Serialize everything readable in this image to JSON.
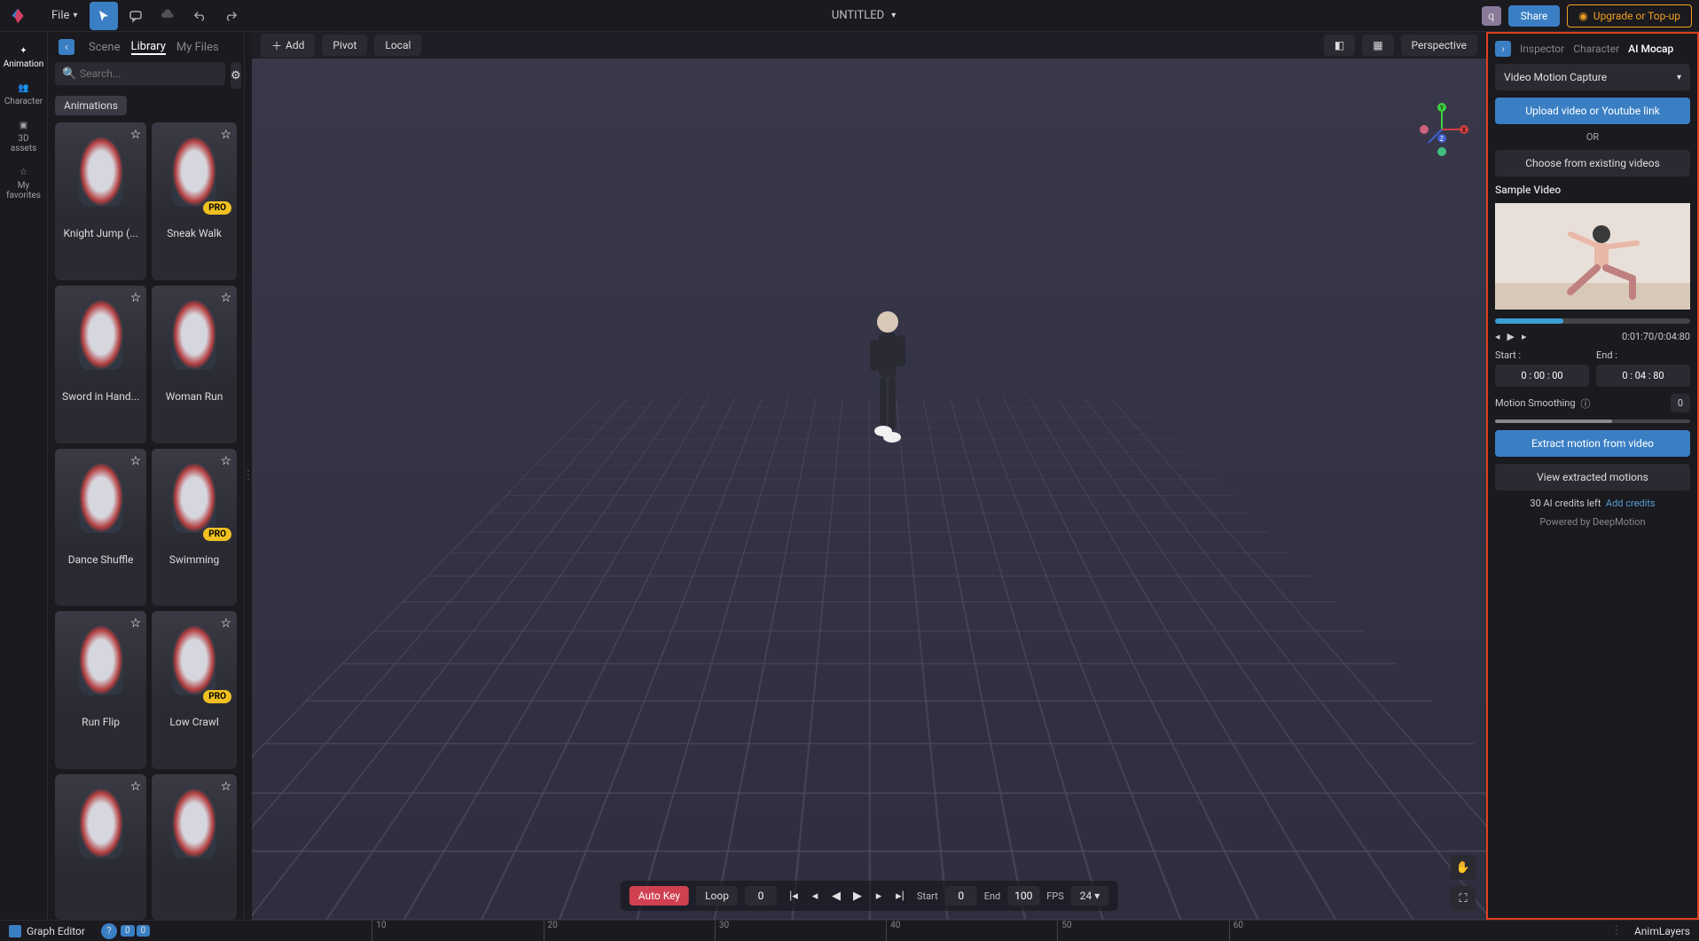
{
  "topbar": {
    "file_label": "File",
    "title": "UNTITLED",
    "avatar_letter": "q",
    "share_label": "Share",
    "upgrade_label": "Upgrade or Top-up"
  },
  "panel_tabs": {
    "scene": "Scene",
    "library": "Library",
    "myfiles": "My Files"
  },
  "search": {
    "placeholder": "Search..."
  },
  "filter_chip": "Animations",
  "rail": {
    "animation": "Animation",
    "character": "Character",
    "assets": "3D assets",
    "favorites": "My favorites"
  },
  "animations": [
    {
      "label": "Knight Jump (...",
      "pro": false
    },
    {
      "label": "Sneak Walk",
      "pro": true
    },
    {
      "label": "Sword in Hand...",
      "pro": false
    },
    {
      "label": "Woman Run",
      "pro": false
    },
    {
      "label": "Dance Shuffle",
      "pro": false
    },
    {
      "label": "Swimming",
      "pro": true
    },
    {
      "label": "Run Flip",
      "pro": false
    },
    {
      "label": "Low Crawl",
      "pro": true
    },
    {
      "label": "",
      "pro": false
    },
    {
      "label": "",
      "pro": false
    }
  ],
  "pro_badge": "PRO",
  "viewport": {
    "add_label": "Add",
    "pivot_label": "Pivot",
    "local_label": "Local",
    "perspective_label": "Perspective"
  },
  "playback": {
    "autokey": "Auto Key",
    "loop": "Loop",
    "frame": "0",
    "start_label": "Start",
    "start_val": "0",
    "end_label": "End",
    "end_val": "100",
    "fps_label": "FPS",
    "fps_val": "24"
  },
  "right": {
    "tabs": {
      "inspector": "Inspector",
      "character": "Character",
      "aimocap": "AI Mocap"
    },
    "mode": "Video Motion Capture",
    "upload": "Upload video or Youtube link",
    "or": "OR",
    "choose": "Choose from existing videos",
    "sample": "Sample Video",
    "time": "0:01:70/0:04:80",
    "start_label": "Start :",
    "start_val": "0 : 00 : 00",
    "end_label": "End :",
    "end_val": "0 : 04 : 80",
    "smoothing": "Motion Smoothing",
    "smoothing_val": "0",
    "extract": "Extract motion from video",
    "view": "View extracted motions",
    "credits_text": "30 AI credits left",
    "add_credits": "Add credits",
    "powered": "Powered by DeepMotion"
  },
  "bottom": {
    "graph": "Graph Editor",
    "zeros": [
      "0",
      "0"
    ],
    "ticks": [
      "10",
      "20",
      "30",
      "40",
      "50",
      "60"
    ],
    "animlayers": "AnimLayers"
  }
}
